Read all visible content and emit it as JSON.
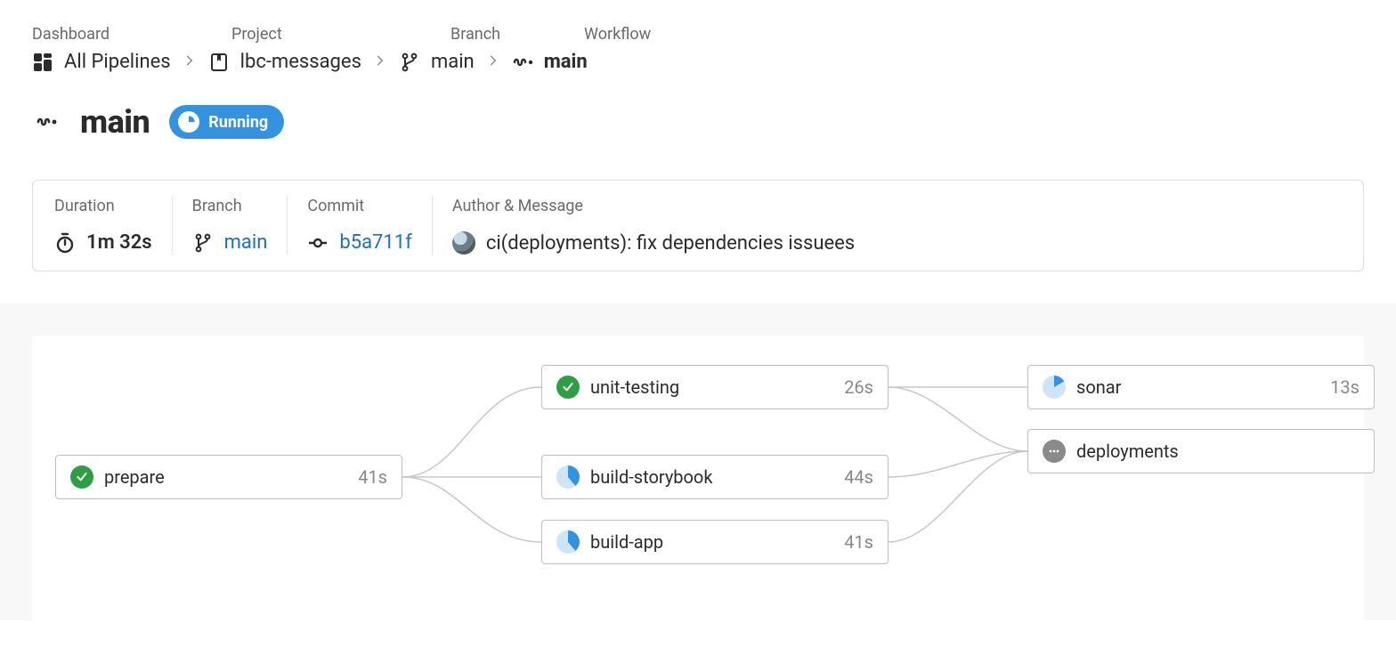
{
  "breadcrumb": {
    "labels": {
      "dashboard": "Dashboard",
      "project": "Project",
      "branch": "Branch",
      "workflow": "Workflow"
    },
    "dashboard": "All Pipelines",
    "project": "lbc-messages",
    "branch": "main",
    "workflow": "main"
  },
  "title": "main",
  "status": {
    "label": "Running",
    "color": "#3493e1"
  },
  "info": {
    "duration": {
      "label": "Duration",
      "value": "1m 32s"
    },
    "branch": {
      "label": "Branch",
      "value": "main"
    },
    "commit": {
      "label": "Commit",
      "value": "b5a711f"
    },
    "author": {
      "label": "Author & Message",
      "message": "ci(deployments): fix dependencies issuees"
    }
  },
  "jobs": {
    "prepare": {
      "name": "prepare",
      "duration": "41s",
      "status": "success"
    },
    "unit": {
      "name": "unit-testing",
      "duration": "26s",
      "status": "success"
    },
    "storybook": {
      "name": "build-storybook",
      "duration": "44s",
      "status": "running"
    },
    "app": {
      "name": "build-app",
      "duration": "41s",
      "status": "running"
    },
    "sonar": {
      "name": "sonar",
      "duration": "13s",
      "status": "running-low"
    },
    "deploy": {
      "name": "deployments",
      "duration": "",
      "status": "queued"
    }
  }
}
